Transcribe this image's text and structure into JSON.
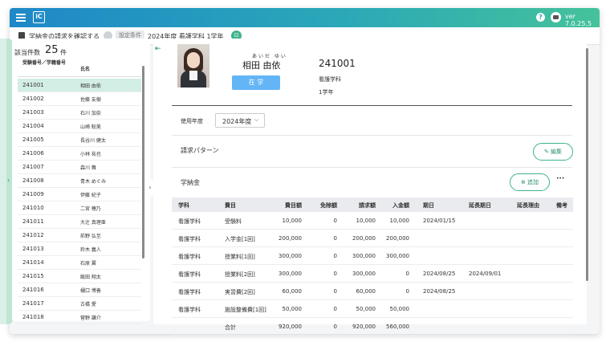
{
  "topbar": {
    "version": "ver 7.0.25.5",
    "logo_text": "iC",
    "help_label": "?"
  },
  "breadcrumb": {
    "title": "学納金の請求を確認する",
    "condition_label": "設定条件",
    "detail": "2024年度 看護学科 1学年",
    "bookmark_glyph": "⊡"
  },
  "student_list": {
    "count_label": "該当件数",
    "count": "25",
    "count_unit": "件",
    "col_id": "受験番号／学籍番号",
    "col_name": "氏名",
    "rows": [
      {
        "id": "241001",
        "name": "相田 由依"
      },
      {
        "id": "241002",
        "name": "佐藤 友樹"
      },
      {
        "id": "241003",
        "name": "石川 加奈"
      },
      {
        "id": "241004",
        "name": "山崎 聡美"
      },
      {
        "id": "241005",
        "name": "長谷川 健太"
      },
      {
        "id": "241006",
        "name": "小林 祐也"
      },
      {
        "id": "241007",
        "name": "森川 舞"
      },
      {
        "id": "241008",
        "name": "青木 めぐみ"
      },
      {
        "id": "241009",
        "name": "伊藤 紀子"
      },
      {
        "id": "241010",
        "name": "二宮 穂乃"
      },
      {
        "id": "241011",
        "name": "大辻 真理亜"
      },
      {
        "id": "241012",
        "name": "前野 弘至"
      },
      {
        "id": "241013",
        "name": "鈴木 義人"
      },
      {
        "id": "241014",
        "name": "石原 翼"
      },
      {
        "id": "241015",
        "name": "飯田 翔太"
      },
      {
        "id": "241016",
        "name": "樋口 博善"
      },
      {
        "id": "241017",
        "name": "古橋 愛"
      },
      {
        "id": "241018",
        "name": "菅野 謙介"
      }
    ]
  },
  "student": {
    "furigana": "あいだ ゆい",
    "name": "相田 由依",
    "status": "在 学",
    "id": "241001",
    "department": "看護学科",
    "grade": "1学年"
  },
  "form": {
    "year_label": "使用年度",
    "year_value": "2024年度",
    "pattern_label": "請求パターン",
    "edit_label": "編集",
    "fee_label": "学納金",
    "add_label": "追加",
    "more_label": "···"
  },
  "fee_table": {
    "headers": [
      "学科",
      "費目",
      "費目額",
      "免除額",
      "請求額",
      "入金額",
      "期日",
      "延長期日",
      "延長理由",
      "備考"
    ],
    "rows": [
      [
        "看護学科",
        "受験料",
        "10,000",
        "0",
        "10,000",
        "10,000",
        "2024/01/15",
        "",
        "",
        ""
      ],
      [
        "看護学科",
        "入学金[1回]",
        "200,000",
        "0",
        "200,000",
        "200,000",
        "",
        "",
        "",
        ""
      ],
      [
        "看護学科",
        "授業料[1回]",
        "300,000",
        "0",
        "300,000",
        "300,000",
        "",
        "",
        "",
        ""
      ],
      [
        "看護学科",
        "授業料[2回]",
        "300,000",
        "0",
        "300,000",
        "0",
        "2024/08/25",
        "2024/09/01",
        "",
        ""
      ],
      [
        "看護学科",
        "実習費[2回]",
        "60,000",
        "0",
        "60,000",
        "0",
        "2024/08/25",
        "",
        "",
        ""
      ],
      [
        "看護学科",
        "施設整備費[1回]",
        "50,000",
        "0",
        "50,000",
        "50,000",
        "",
        "",
        "",
        ""
      ],
      [
        "",
        "合計",
        "920,000",
        "0",
        "920,000",
        "560,000",
        "",
        "",
        "",
        ""
      ]
    ]
  },
  "colors": {
    "accent": "#3db48a",
    "header_start": "#1e88c8",
    "header_end": "#45c29b",
    "status_badge": "#64b5f6",
    "selected_row": "#d3eee4"
  }
}
